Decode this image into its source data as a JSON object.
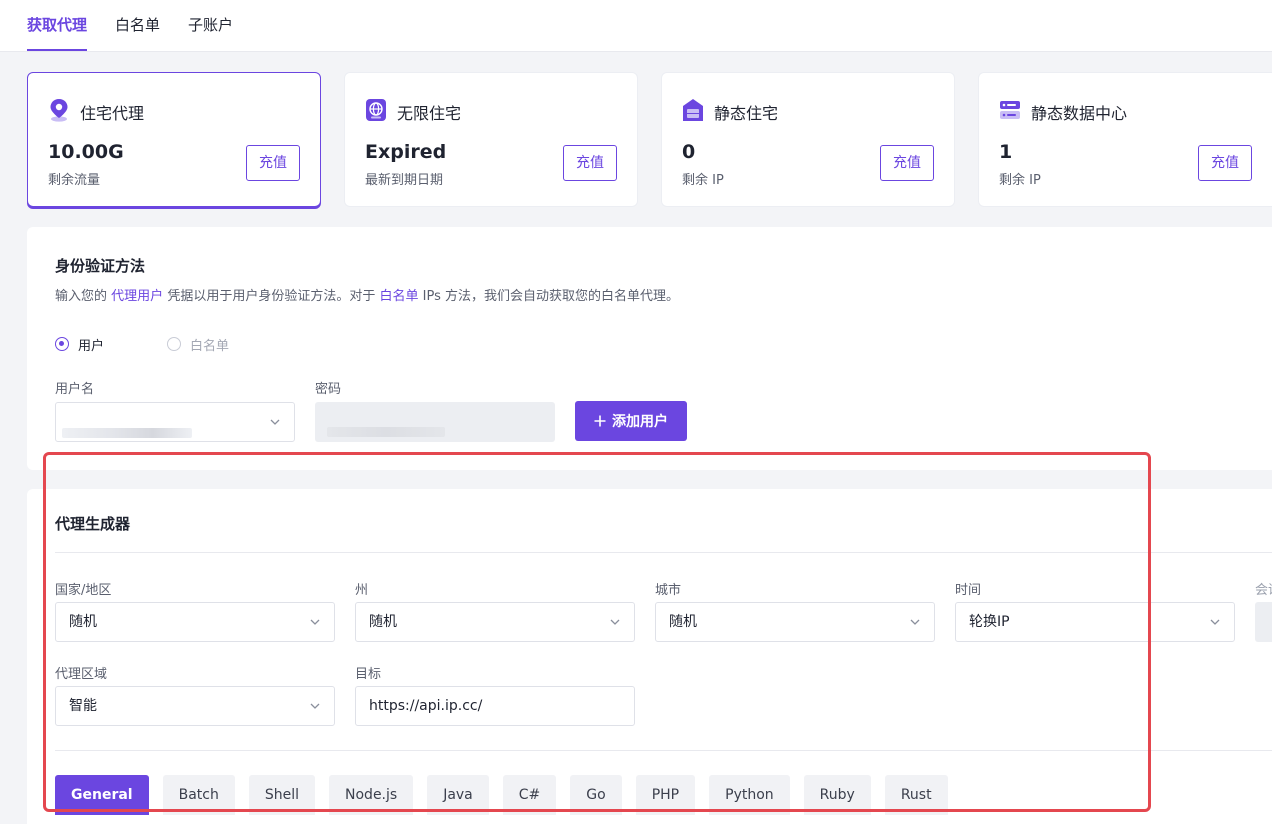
{
  "topnav": {
    "tabs": [
      "获取代理",
      "白名单",
      "子账户"
    ],
    "active_index": 0
  },
  "cards": [
    {
      "title": "住宅代理",
      "value": "10.00G",
      "sub": "剩余流量",
      "button": "充值",
      "icon": "location-pin-icon",
      "selected": true
    },
    {
      "title": "无限住宅",
      "value": "Expired",
      "sub": "最新到期日期",
      "button": "充值",
      "icon": "globe-icon",
      "selected": false
    },
    {
      "title": "静态住宅",
      "value": "0",
      "sub": "剩余 IP",
      "button": "充值",
      "icon": "house-icon",
      "selected": false
    },
    {
      "title": "静态数据中心",
      "value": "1",
      "sub": "剩余 IP",
      "button": "充值",
      "icon": "server-icon",
      "selected": false
    }
  ],
  "auth": {
    "title": "身份验证方法",
    "desc_1": "输入您的",
    "desc_link_1": "代理用户",
    "desc_2": "凭据以用于用户身份验证方法。对于",
    "desc_link_2": "白名单",
    "desc_3": "IPs 方法，我们会自动获取您的白名单代理。",
    "radio_user": "用户",
    "radio_whitelist": "白名单",
    "username_label": "用户名",
    "password_label": "密码",
    "add_user_button": "添加用户"
  },
  "generator": {
    "title": "代理生成器",
    "country_label": "国家/地区",
    "country_value": "随机",
    "state_label": "州",
    "state_value": "随机",
    "city_label": "城市",
    "city_value": "随机",
    "time_label": "时间",
    "time_value": "轮换IP",
    "session_label_cut": "会话",
    "region_label": "代理区域",
    "region_value": "智能",
    "target_label": "目标",
    "target_value": "https://api.ip.cc/",
    "languages": [
      "General",
      "Batch",
      "Shell",
      "Node.js",
      "Java",
      "C#",
      "Go",
      "PHP",
      "Python",
      "Ruby",
      "Rust"
    ],
    "active_language_index": 0
  },
  "colors": {
    "accent": "#6b46e0",
    "highlight_border": "#e4474f"
  }
}
